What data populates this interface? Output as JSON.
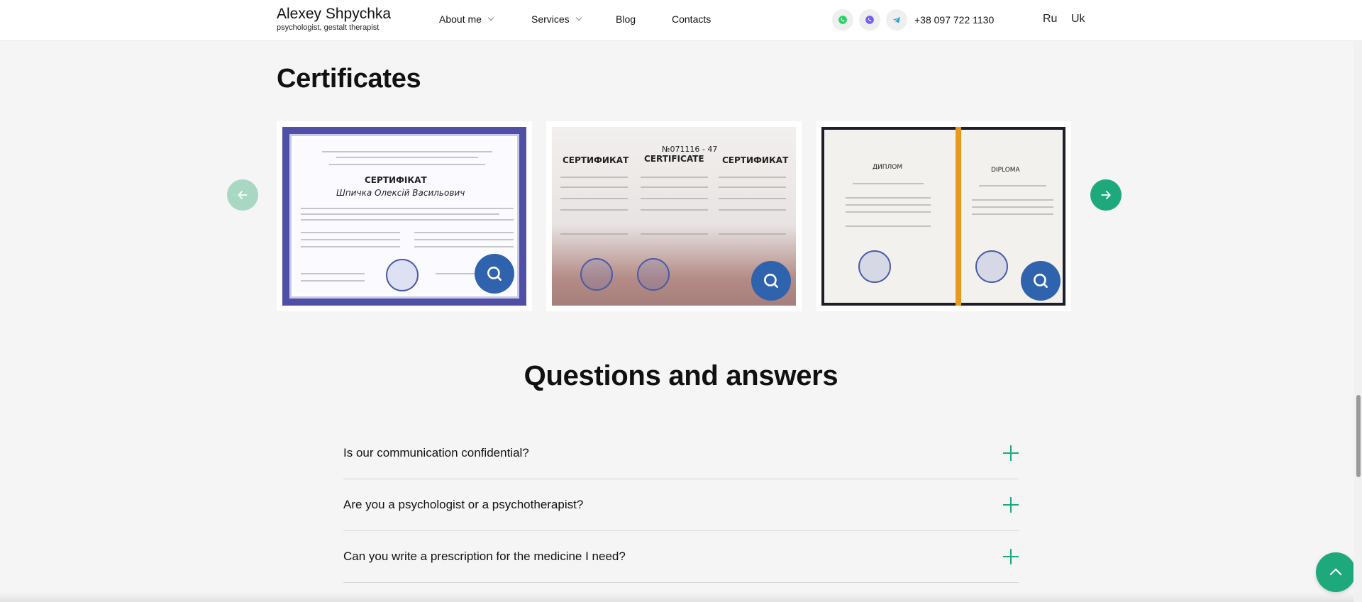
{
  "header": {
    "logo_name": "Alexey Shpychka",
    "logo_sub": "psychologist, gestalt therapist",
    "nav": [
      {
        "label": "About me",
        "has_dropdown": true
      },
      {
        "label": "Services",
        "has_dropdown": true
      },
      {
        "label": "Blog",
        "has_dropdown": false
      },
      {
        "label": "Contacts",
        "has_dropdown": false
      }
    ],
    "socials": [
      {
        "icon": "whatsapp-icon",
        "color": "#25d366"
      },
      {
        "icon": "viber-icon",
        "color": "#7360f2"
      },
      {
        "icon": "telegram-icon",
        "color": "#2aa3d8"
      }
    ],
    "phone": "+38 097 722 1130",
    "languages": [
      "Ru",
      "Uk"
    ]
  },
  "certificates": {
    "title": "Certificates",
    "items": [
      {
        "heading": "СЕРТИФІКАТ",
        "name": "Шпичка Олексій Васильович"
      },
      {
        "headings": [
          "СЕРТИФИКАТ",
          "CERTIFICATE",
          "СЕРТИФИКАТ"
        ],
        "number": "№071116 - 47"
      },
      {
        "headings": [
          "ДИПЛОМ",
          "DIPLOMA"
        ]
      }
    ]
  },
  "faq": {
    "title": "Questions and answers",
    "items": [
      {
        "question": "Is our communication confidential?"
      },
      {
        "question": "Are you a psychologist or a psychotherapist?"
      },
      {
        "question": "Can you write a prescription for the medicine I need?"
      }
    ]
  },
  "colors": {
    "accent": "#1ea97c",
    "accent_light": "#a8d8c4",
    "zoom_button": "#2f63ad",
    "background": "#f5f5f5"
  }
}
